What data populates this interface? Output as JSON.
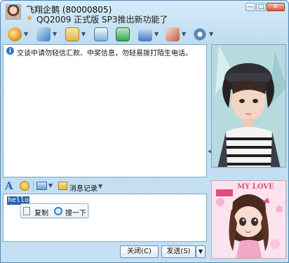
{
  "titlebar": {
    "contact_name": "飞翔企鹅 (80000805)",
    "signature": "QQ2009 正式版 SP3推出新功能了",
    "star_glyph": "★",
    "min_glyph": "—",
    "max_glyph": "□",
    "close_glyph": "✕"
  },
  "toolbar": {
    "dropdown_glyph": "▼",
    "items": [
      {
        "icon": "video-call-icon",
        "color": "#e39a1d"
      },
      {
        "icon": "voice-call-icon",
        "color": "#3e7fc4"
      },
      {
        "icon": "send-file-icon",
        "color": "#e0b34a"
      },
      {
        "icon": "send-email-icon",
        "color": "#7fb0d8"
      },
      {
        "icon": "create-group-icon",
        "color": "#3aa353"
      },
      {
        "icon": "app-icon",
        "color": "#3f77b8"
      },
      {
        "icon": "remote-assist-icon",
        "color": "#c05a3c"
      },
      {
        "icon": "settings-icon",
        "color": "#5b86b8"
      }
    ]
  },
  "chat": {
    "notice": "交谈中请勿轻信汇款、中奖信息，勿轻易拨打陌生电话。"
  },
  "format_bar": {
    "font_glyph": "A",
    "history_label": "消息记录",
    "dropdown_glyph": "▼"
  },
  "input": {
    "text": "hello"
  },
  "context_menu": {
    "copy_label": "复制",
    "search_label": "搜一下"
  },
  "buttons": {
    "close_label": "关闭(C)",
    "send_label": "发送(S)",
    "send_dropdown_glyph": "▼"
  },
  "side": {
    "collapse_glyph": "◀",
    "banner_text": "MY LOVE"
  }
}
